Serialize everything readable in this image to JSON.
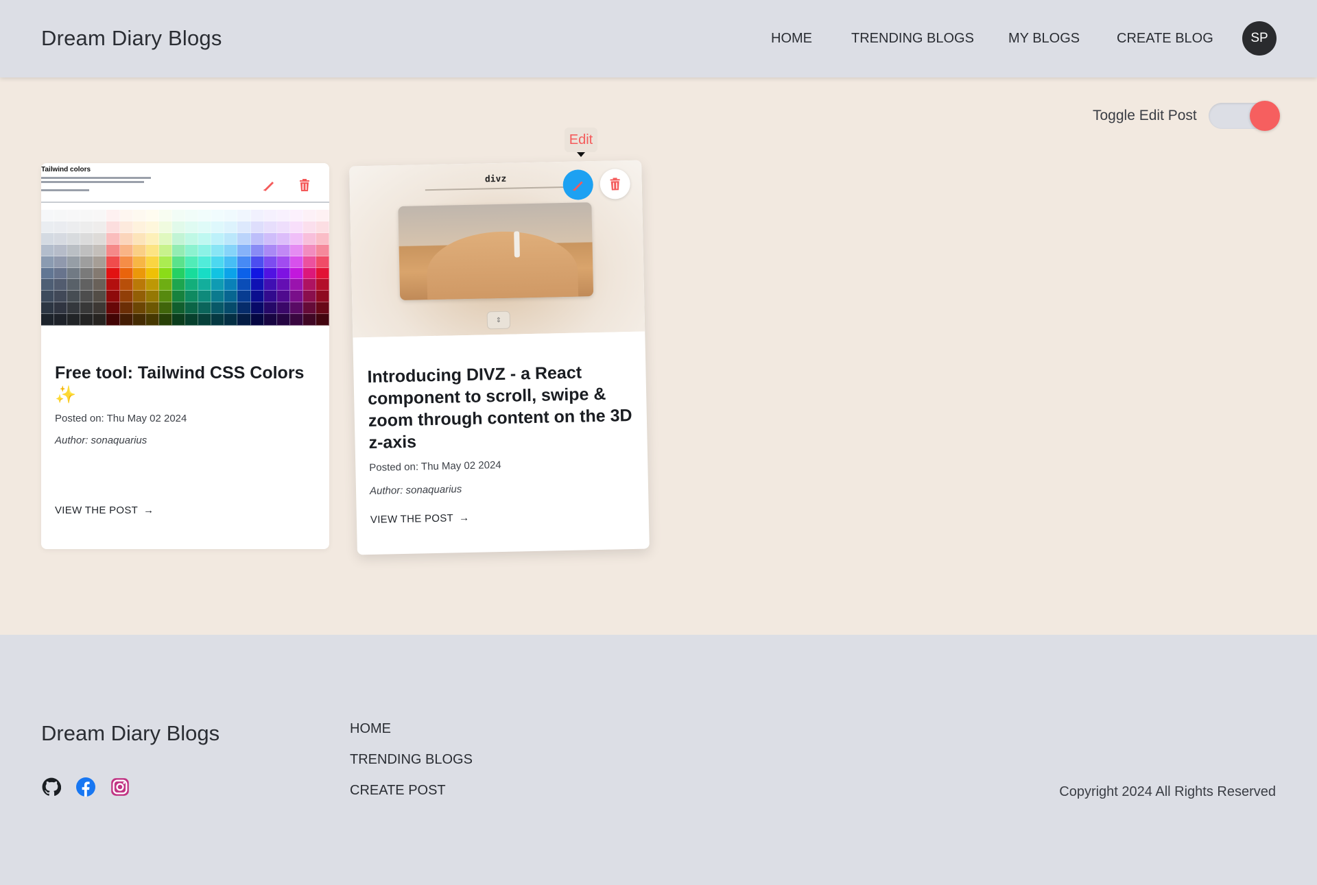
{
  "header": {
    "brand": "Dream Diary Blogs",
    "nav": [
      "HOME",
      "TRENDING BLOGS",
      "MY BLOGS",
      "CREATE BLOG"
    ],
    "avatar": "SP"
  },
  "toolbar": {
    "toggle_label": "Toggle Edit Post",
    "toggle_on": true,
    "tooltip": "Edit"
  },
  "posts": [
    {
      "title": "Free tool: Tailwind CSS Colors ✨",
      "posted_label": "Posted on:",
      "posted_date": "Thu May 02 2024",
      "author": "Author: sonaquarius",
      "link": "VIEW THE POST",
      "thumb_title": "Tailwind colors"
    },
    {
      "title": "Introducing DIVZ - a React component to scroll, swipe & zoom through content on the 3D z-axis",
      "posted_label": "Posted on:",
      "posted_date": "Thu May 02 2024",
      "author": "Author: sonaquarius",
      "link": "VIEW THE POST",
      "thumb_title": "divz"
    }
  ],
  "footer": {
    "brand": "Dream Diary Blogs",
    "links": [
      "HOME",
      "TRENDING BLOGS",
      "CREATE POST"
    ],
    "socials": [
      "github-icon",
      "facebook-icon",
      "instagram-icon"
    ],
    "copyright": "Copyright 2024 All Rights Reserved"
  },
  "colors": {
    "header_bg": "#dcdee5",
    "page_bg": "#f2e9e0",
    "accent_red": "#f65f5f",
    "edit_blue": "#1da1f2"
  }
}
